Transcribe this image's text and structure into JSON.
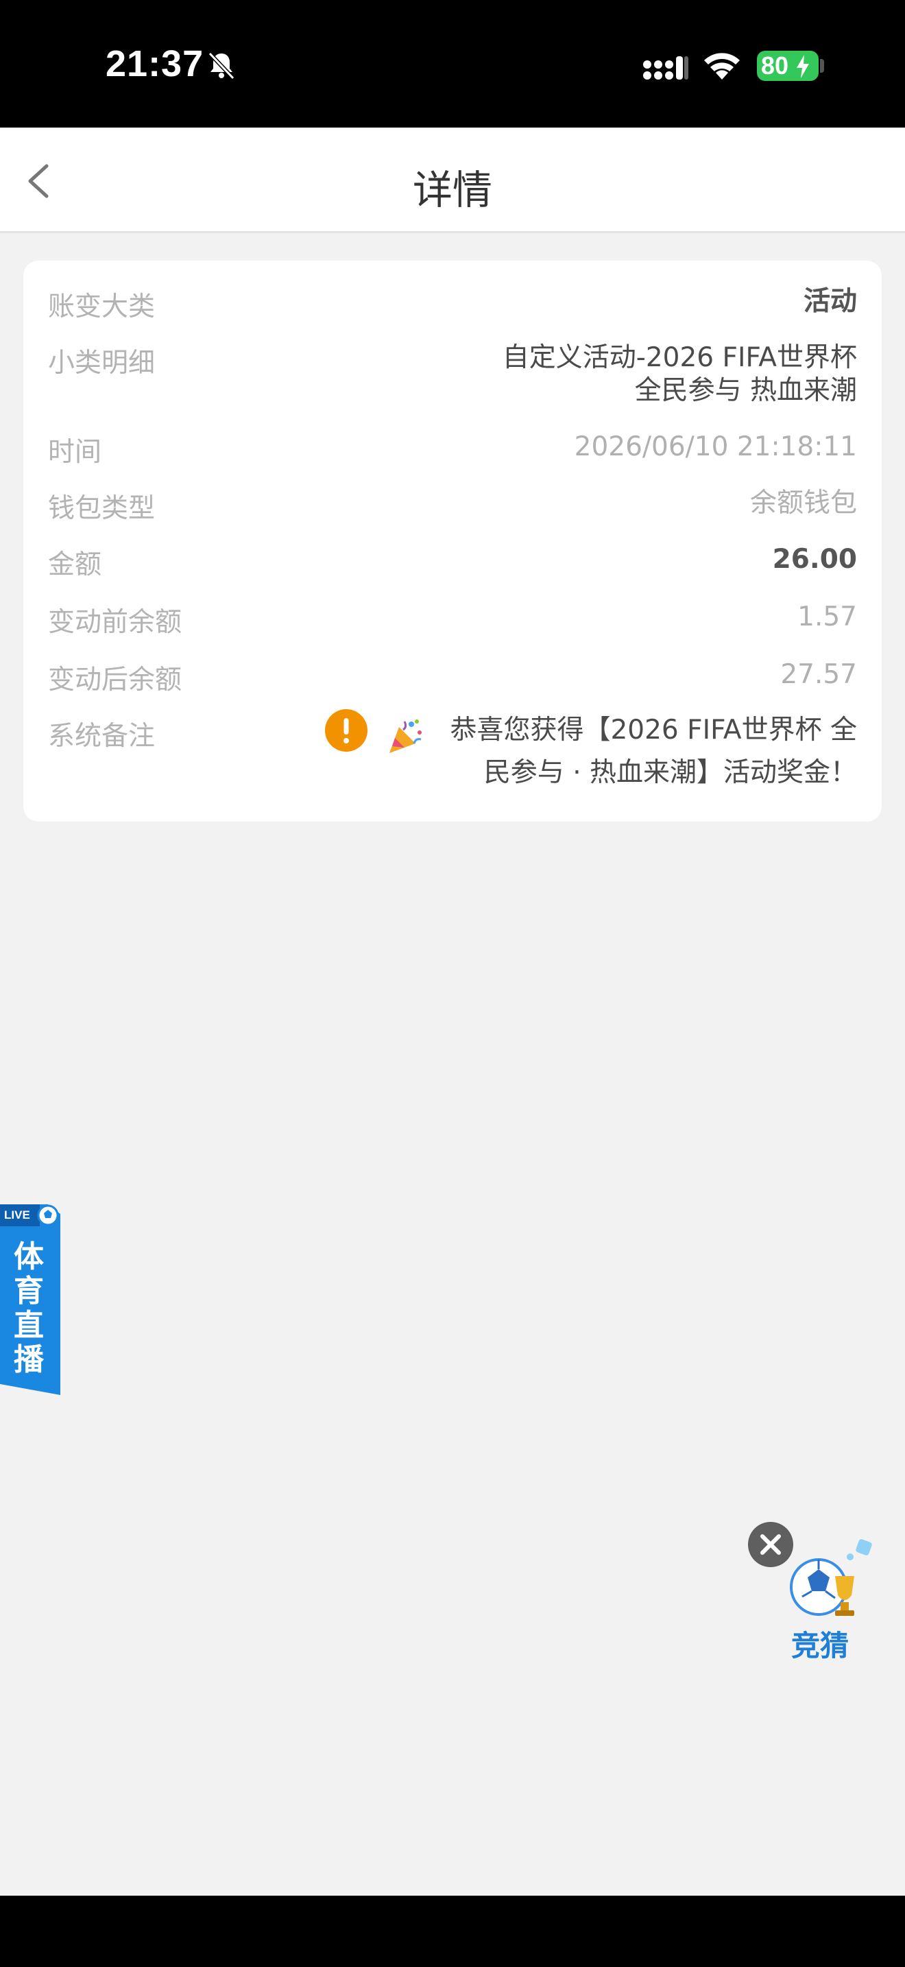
{
  "status_bar": {
    "time": "21:37",
    "battery": "80"
  },
  "nav": {
    "title": "详情"
  },
  "details": [
    {
      "label": "账变大类",
      "value": "活动"
    },
    {
      "label": "小类明细",
      "value_lines": [
        "自定义活动-2026 FIFA世界杯",
        "全民参与 热血来潮"
      ]
    },
    {
      "label": "时间",
      "value": "2026/06/10 21:18:11"
    },
    {
      "label": "钱包类型",
      "value": "余额钱包"
    },
    {
      "label": "金额",
      "value": "26.00"
    },
    {
      "label": "变动前余额",
      "value": "1.57"
    },
    {
      "label": "变动后余额",
      "value": "27.57"
    },
    {
      "label": "系统备注",
      "value_lines": [
        "恭喜您获得【2026 FIFA世界杯 全",
        "民参与 · 热血来潮】活动奖金！"
      ]
    }
  ],
  "live_widget": {
    "badge": "LIVE",
    "text": "体育直播"
  },
  "guess_widget": {
    "label": "竞猜"
  },
  "colors": {
    "warning": "#f39200",
    "live_blue": "#1a87e0",
    "guess_blue": "#1f7fd6",
    "battery_green": "#34c759"
  }
}
